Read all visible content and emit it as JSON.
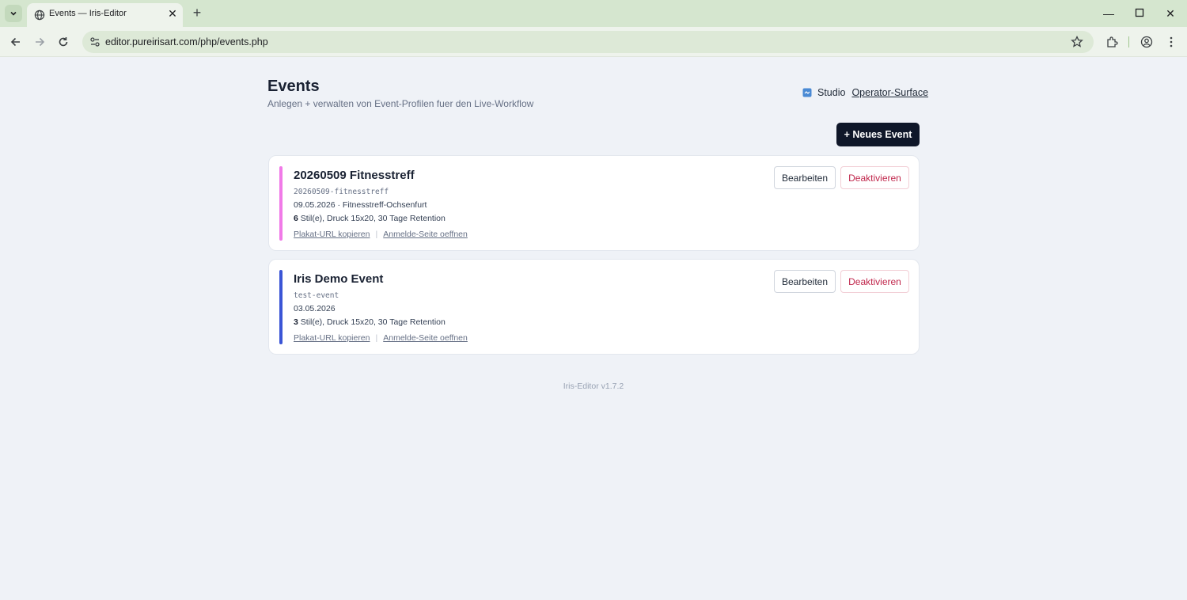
{
  "browser": {
    "tab_title": "Events — Iris-Editor",
    "url": "editor.pureirisart.com/php/events.php"
  },
  "header": {
    "title": "Events",
    "subtitle": "Anlegen + verwalten von Event-Profilen fuer den Live-Workflow",
    "studio_label": "Studio",
    "studio_link": "Operator-Surface"
  },
  "actions": {
    "new_event": "+ Neues Event"
  },
  "events": [
    {
      "title": "20260509 Fitnesstreff",
      "slug": "20260509-fitnesstreff",
      "meta": "09.05.2026 · Fitnesstreff-Ochsenfurt",
      "style_count": "6",
      "style_text": " Stil(e), Druck 15x20, 30 Tage Retention",
      "link_poster": "Plakat-URL kopieren",
      "link_signup": "Anmelde-Seite oeffnen",
      "edit_label": "Bearbeiten",
      "deactivate_label": "Deaktivieren",
      "color": "#f17ae8"
    },
    {
      "title": "Iris Demo Event",
      "slug": "test-event",
      "meta": "03.05.2026",
      "style_count": "3",
      "style_text": " Stil(e), Druck 15x20, 30 Tage Retention",
      "link_poster": "Plakat-URL kopieren",
      "link_signup": "Anmelde-Seite oeffnen",
      "edit_label": "Bearbeiten",
      "deactivate_label": "Deaktivieren",
      "color": "#3b55d6"
    }
  ],
  "footer": {
    "version": "Iris-Editor v1.7.2"
  }
}
